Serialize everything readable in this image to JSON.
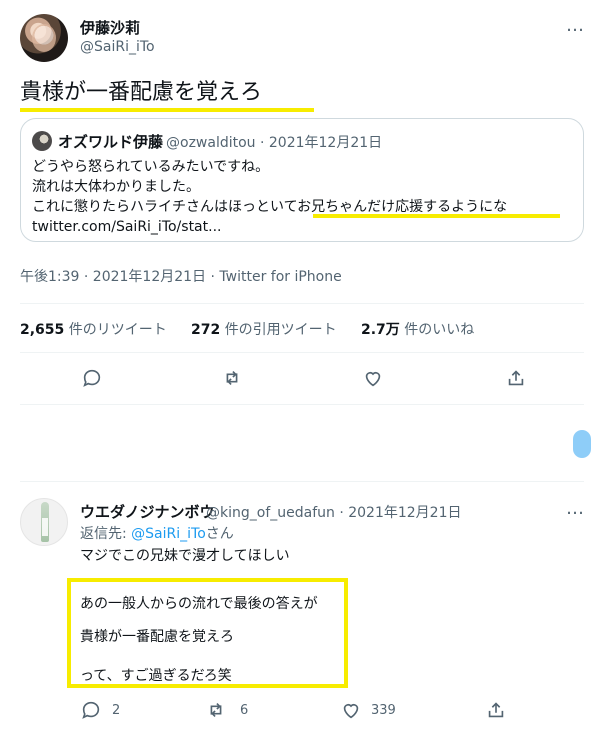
{
  "main_tweet": {
    "display_name": "伊藤沙莉",
    "handle": "@SaiRi_iTo",
    "text": "貴様が一番配慮を覚えろ",
    "meta": "午後1:39 · 2021年12月21日 · Twitter for iPhone",
    "more_icon": "…",
    "stats": [
      {
        "count": "2,655",
        "label": "件のリツイート"
      },
      {
        "count": "272",
        "label": "件の引用ツイート"
      },
      {
        "count": "2.7万",
        "label": "件のいいね"
      }
    ],
    "actions": [
      "reply-icon",
      "retweet-icon",
      "like-icon",
      "share-icon"
    ]
  },
  "quote_tweet": {
    "display_name": "オズワルド伊藤",
    "handle_date": "@ozwalditou · 2021年12月21日",
    "lines": [
      "どうやら怒られているみたいですね。",
      "流れは大体わかりました。",
      "これに懲りたらハライチさんはほっといてお兄ちゃんだけ応援するようにな",
      "twitter.com/SaiRi_iTo/stat..."
    ]
  },
  "reply_tweet": {
    "display_name": "ウエダノジナンボウ",
    "handle_date": "@king_of_uedafun · 2021年12月21日",
    "reply_to_prefix": "返信先: ",
    "reply_to_mention": "@SaiRi_iTo",
    "reply_to_suffix": "さん",
    "line1": "マジでこの兄妹で漫才してほしい",
    "body_lines": [
      "あの一般人からの流れで最後の答えが",
      "貴様が一番配慮を覚えろ",
      "って、すご過ぎるだろ笑"
    ],
    "reply_count": "2",
    "retweet_count": "6",
    "like_count": "339",
    "more_icon": "…"
  },
  "colors": {
    "highlight": "#f7ec00",
    "link": "#1d9bf0",
    "muted": "#536471"
  }
}
